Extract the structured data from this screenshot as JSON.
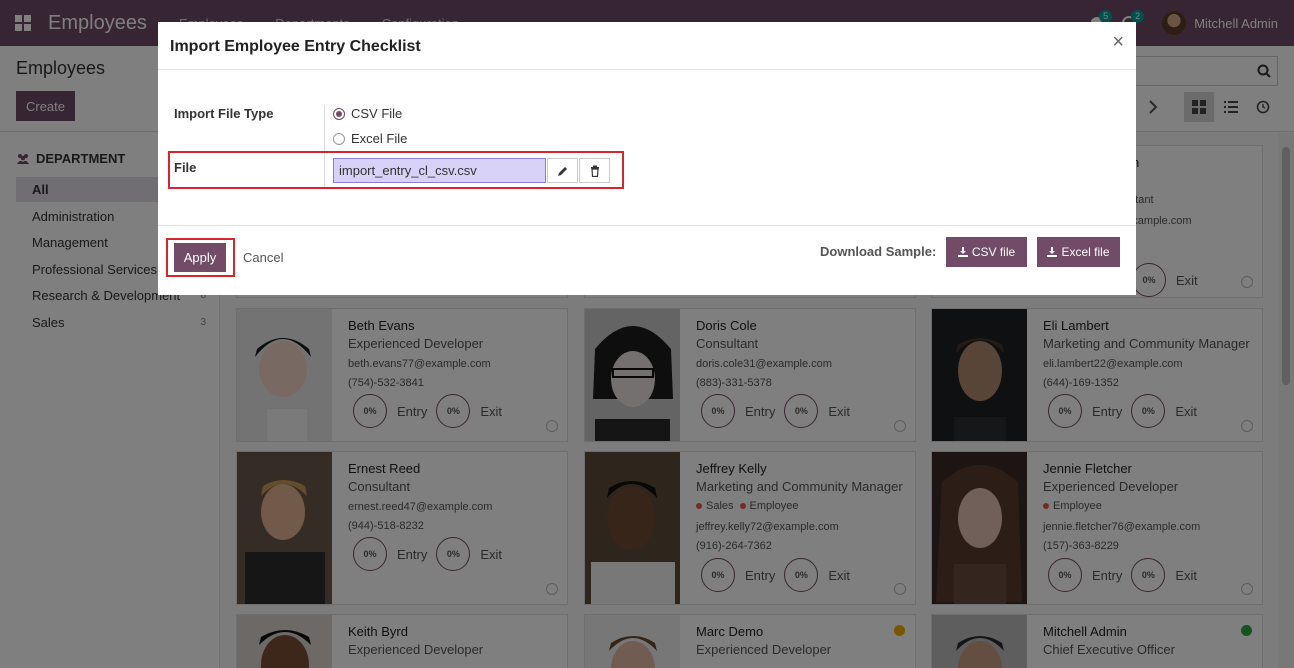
{
  "navbar": {
    "brand": "Employees",
    "menu": [
      "Employees",
      "Departments",
      "Configuration"
    ],
    "messages_count": "5",
    "activities_count": "2",
    "user": "Mitchell Admin"
  },
  "control_panel": {
    "title": "Employees",
    "create_label": "Create"
  },
  "sidebar": {
    "heading": "DEPARTMENT",
    "items": [
      {
        "label": "All",
        "count": ""
      },
      {
        "label": "Administration",
        "count": ""
      },
      {
        "label": "Management",
        "count": ""
      },
      {
        "label": "Professional Services",
        "count": ""
      },
      {
        "label": "Research & Development",
        "count": "8"
      },
      {
        "label": "Sales",
        "count": "3"
      }
    ]
  },
  "cards": [
    {
      "name": "Beth Evans",
      "job": "Experienced Developer",
      "email": "beth.evans77@example.com",
      "phone": "(754)-532-3841",
      "entry": "0%",
      "exit": "0%",
      "tags": []
    },
    {
      "name": "Doris Cole",
      "job": "Consultant",
      "email": "doris.cole31@example.com",
      "phone": "(883)-331-5378",
      "entry": "0%",
      "exit": "0%",
      "tags": []
    },
    {
      "name": "Eli Lambert",
      "job": "Marketing and Community Manager",
      "email": "eli.lambert22@example.com",
      "phone": "(644)-169-1352",
      "entry": "0%",
      "exit": "0%",
      "tags": []
    },
    {
      "name": "Ernest Reed",
      "job": "Consultant",
      "email": "ernest.reed47@example.com",
      "phone": "(944)-518-8232",
      "entry": "0%",
      "exit": "0%",
      "tags": []
    },
    {
      "name": "Jeffrey Kelly",
      "job": "Marketing and Community Manager",
      "email": "jeffrey.kelly72@example.com",
      "phone": "(916)-264-7362",
      "entry": "0%",
      "exit": "0%",
      "tags": [
        "Sales",
        "Employee"
      ]
    },
    {
      "name": "Jennie Fletcher",
      "job": "Experienced Developer",
      "email": "jennie.fletcher76@example.com",
      "phone": "(157)-363-8229",
      "entry": "0%",
      "exit": "0%",
      "tags": [
        "Employee"
      ]
    },
    {
      "name": "Keith Byrd",
      "job": "Experienced Developer"
    },
    {
      "name": "Marc Demo",
      "job": "Experienced Developer"
    },
    {
      "name": "Mitchell Admin",
      "job": "Chief Executive Officer"
    }
  ],
  "partial_top": {
    "job_fragment": "nsultant",
    "email_fragment": "@example.com",
    "name_fragment": "n",
    "exit_pct": "0%",
    "exit_label": "Exit"
  },
  "labels": {
    "entry": "Entry",
    "exit": "Exit"
  },
  "modal": {
    "title": "Import Employee Entry Checklist",
    "close": "×",
    "file_type_label": "Import File Type",
    "options": [
      "CSV File",
      "Excel File"
    ],
    "selected_option": "CSV File",
    "file_label": "File",
    "file_value": "import_entry_cl_csv.csv",
    "apply_label": "Apply",
    "cancel_label": "Cancel",
    "download_label": "Download Sample:",
    "csv_button": "CSV file",
    "excel_button": "Excel file"
  },
  "colors": {
    "brand": "#714b67",
    "highlight": "#d9232d",
    "status_orange": "#f0ad00",
    "status_green": "#28a745"
  }
}
